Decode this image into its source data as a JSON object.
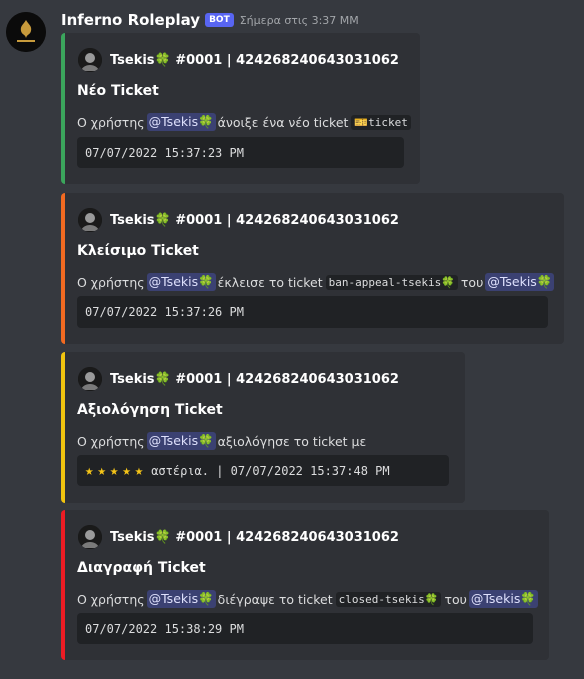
{
  "message": {
    "username": "Inferno Roleplay",
    "bot_tag": "BOT",
    "timestamp": "Σήμερα στις 3:37 ΜΜ"
  },
  "colors": {
    "background": "#36393f",
    "embed_bg": "#2f3136",
    "bar_green": "#3ba55c",
    "bar_orange": "#f26a21",
    "bar_yellow": "#f1c40f",
    "bar_red": "#ed1c24",
    "mention": "#5865f2"
  },
  "embeds": [
    {
      "author": "Tsekis🍀 #0001 | 424268240643031062",
      "title": "Νέο Ticket",
      "desc_prefix": "Ο χρήστης",
      "mention": "@Tsekis🍀",
      "desc_middle": "άνοιξε ένα νέο ticket",
      "code_icon": "🎫",
      "code": "ticket",
      "block": "07/07/2022 15:37:23 PM"
    },
    {
      "author": "Tsekis🍀 #0001 | 424268240643031062",
      "title": "Κλείσιμο Ticket",
      "desc_prefix": "Ο χρήστης",
      "mention": "@Tsekis🍀",
      "desc_middle": "έκλεισε το ticket",
      "code": "ban-appeal-tsekis🍀",
      "desc_suffix": "του",
      "mention2": "@Tsekis🍀",
      "block": "07/07/2022 15:37:26 PM"
    },
    {
      "author": "Tsekis🍀 #0001 | 424268240643031062",
      "title": "Αξιολόγηση Ticket",
      "desc_prefix": "Ο χρήστης",
      "mention": "@Tsekis🍀",
      "desc_middle": "αξιολόγησε το ticket με",
      "stars": 5,
      "star_glyph": "★",
      "block": "αστέρια. | 07/07/2022 15:37:48 PM"
    },
    {
      "author": "Tsekis🍀 #0001 | 424268240643031062",
      "title": "Διαγραφή Ticket",
      "desc_prefix": "Ο χρήστης",
      "mention": "@Tsekis🍀",
      "desc_middle": "διέγραψε το ticket",
      "code": "closed-tsekis🍀",
      "desc_suffix": "του",
      "mention2": "@Tsekis🍀",
      "block": "07/07/2022 15:38:29 PM"
    }
  ]
}
